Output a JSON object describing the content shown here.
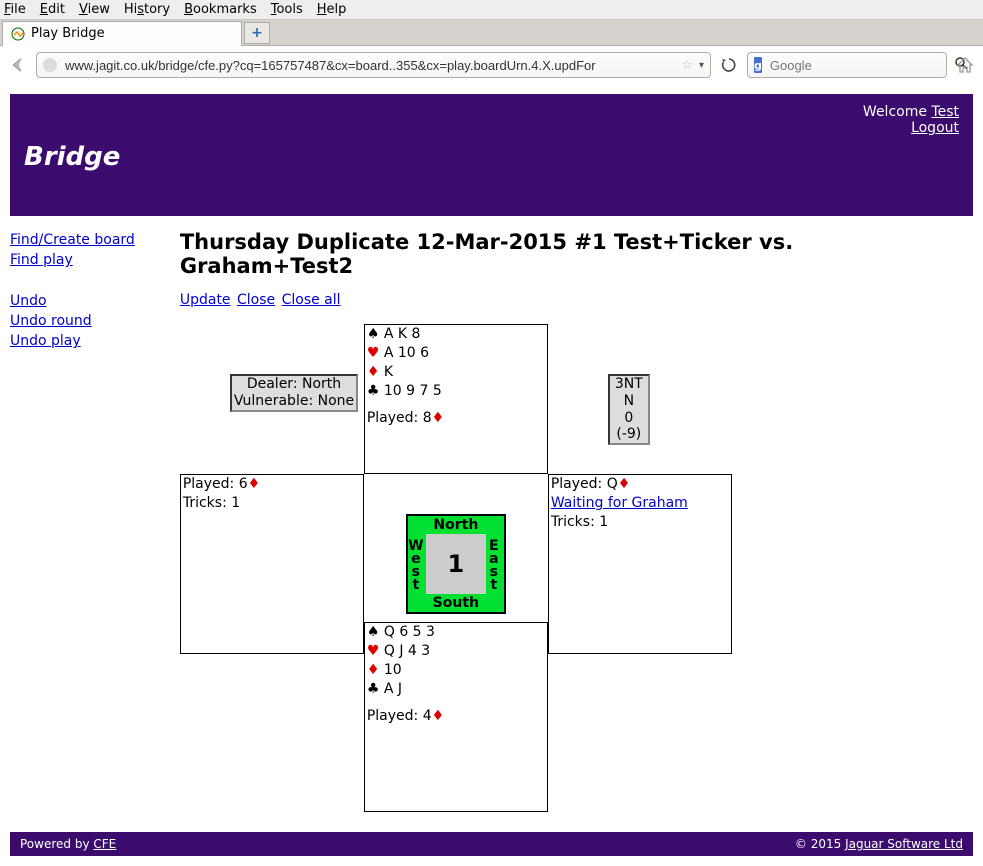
{
  "menu": {
    "file": "File",
    "edit": "Edit",
    "view": "View",
    "history": "History",
    "bookmarks": "Bookmarks",
    "tools": "Tools",
    "help": "Help"
  },
  "tab": {
    "title": "Play Bridge"
  },
  "url": "www.jagit.co.uk/bridge/cfe.py?cq=165757487&cx=board..355&cx=play.boardUrn.4.X.updFor",
  "search": {
    "placeholder": "Google"
  },
  "banner": {
    "title": "Bridge",
    "welcome_pre": "Welcome ",
    "welcome_user": "Test",
    "logout": "Logout"
  },
  "sidebar": {
    "find_create_board": "Find/Create board",
    "find_play": "Find play",
    "undo": "Undo",
    "undo_round": "Undo round",
    "undo_play": "Undo play"
  },
  "heading": "Thursday Duplicate 12-Mar-2015 #1 Test+Ticker vs. Graham+Test2",
  "actions": {
    "update": "Update",
    "close": "Close",
    "close_all": "Close all"
  },
  "dealbox": {
    "dealer": "Dealer: North",
    "vuln": "Vulnerable: None"
  },
  "contract": {
    "line1": "3NT N",
    "line2": "0 (-9)"
  },
  "compass": {
    "n": "North",
    "s": "South",
    "w": "West",
    "e": "East",
    "num": "1"
  },
  "hands": {
    "north": {
      "spades": "A K 8",
      "hearts": "A 10 6",
      "diamonds": "K",
      "clubs": "10 9 7 5",
      "played_label": "Played: ",
      "played_card": "8",
      "played_suit": "d"
    },
    "south": {
      "spades": "Q 6 5 3",
      "hearts": "Q J 4 3",
      "diamonds": "10",
      "clubs": "A J",
      "played_label": "Played: ",
      "played_card": "4",
      "played_suit": "d"
    },
    "west": {
      "played_label": "Played: ",
      "played_card": "6",
      "played_suit": "d",
      "tricks": "Tricks: 1"
    },
    "east": {
      "played_label": "Played: ",
      "played_card": "Q",
      "played_suit": "d",
      "waiting": "Waiting for Graham",
      "tricks": "Tricks: 1"
    }
  },
  "footer": {
    "powered_pre": "Powered by ",
    "powered_link": "CFE",
    "copyright_pre": "© 2015 ",
    "copyright_link": "Jaguar Software Ltd"
  }
}
